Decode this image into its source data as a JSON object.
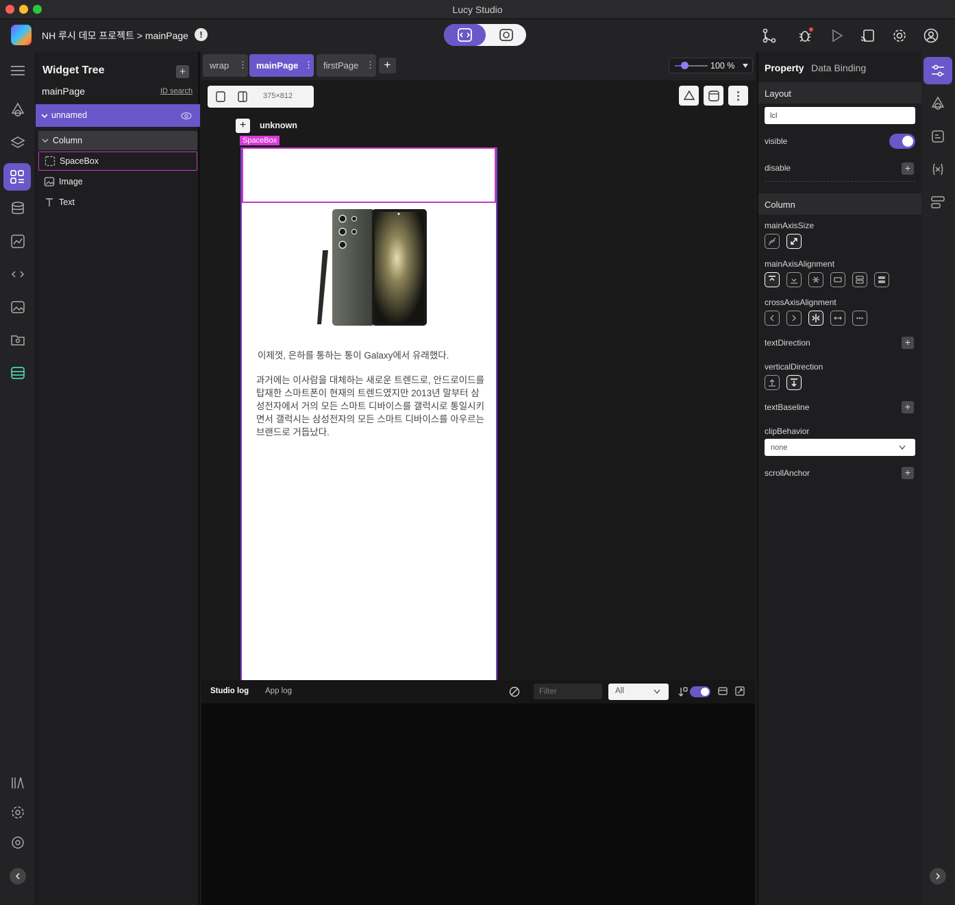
{
  "app": {
    "title": "Lucy Studio"
  },
  "header": {
    "breadcrumb": "NH 루시 데모 프로젝트 > mainPage",
    "warning": "!"
  },
  "widget_tree": {
    "title": "Widget Tree",
    "add": "+",
    "page": "mainPage",
    "id_search": "ID search",
    "root": "unnamed",
    "items": [
      {
        "label": "Column",
        "icon": "chevron-down-icon"
      },
      {
        "label": "SpaceBox",
        "icon": "spacebox-icon"
      },
      {
        "label": "Image",
        "icon": "image-icon"
      },
      {
        "label": "Text",
        "icon": "text-icon"
      }
    ]
  },
  "tabs": [
    {
      "label": "wrap"
    },
    {
      "label": "mainPage"
    },
    {
      "label": "firstPage"
    }
  ],
  "tab_add": "+",
  "zoom": {
    "value": "100 %",
    "level": 0.3
  },
  "device": {
    "size": "375×812"
  },
  "canvas": {
    "unknown_label": "unknown",
    "spacebox_tag": "SpaceBox",
    "heading": "이제껏, 은하를 통하는 통이 Galaxy에서 유래했다.",
    "body": "과거에는 이사람을 대체하는 새로운 트렌드로, 안드로이드를 탑재한 스마트폰이 현재의 트렌드였지만 2013년 말부터 삼성전자에서 거의 모든 스마트 디바이스를 갤럭시로 통일시키면서 갤럭시는 삼성전자의 모든 스마트 디바이스를 아우르는 브랜드로 거듭났다."
  },
  "log": {
    "tabs": [
      "Studio log",
      "App log"
    ],
    "filter_placeholder": "Filter",
    "level": "All"
  },
  "props": {
    "tabs": [
      "Property",
      "Data Binding"
    ],
    "layout": {
      "title": "Layout",
      "id_value": "lcl",
      "visible_label": "visible",
      "visible": true,
      "disable_label": "disable"
    },
    "column": {
      "title": "Column",
      "fields": [
        "mainAxisSize",
        "mainAxisAlignment",
        "crossAxisAlignment",
        "textDirection",
        "verticalDirection",
        "textBaseline",
        "clipBehavior",
        "scrollAnchor"
      ],
      "clip_value": "none"
    }
  },
  "colors": {
    "accent": "#6a57c9",
    "selection": "#c537c5",
    "bg": "#1c1c1e"
  }
}
